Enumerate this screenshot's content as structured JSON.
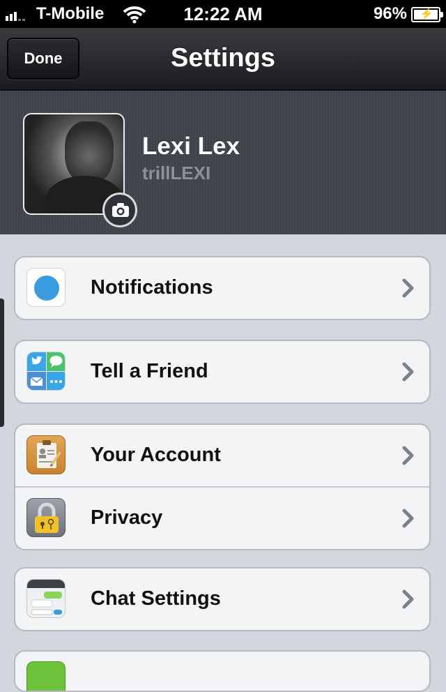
{
  "status_bar": {
    "carrier": "T-Mobile",
    "time": "12:22 AM",
    "battery": "96%"
  },
  "nav": {
    "done_label": "Done",
    "title": "Settings"
  },
  "profile": {
    "name": "Lexi Lex",
    "handle": "trillLEXI"
  },
  "settings": {
    "groups": [
      {
        "rows": [
          {
            "label": "Notifications",
            "icon": "notifications-icon"
          }
        ]
      },
      {
        "rows": [
          {
            "label": "Tell a Friend",
            "icon": "tell-a-friend-icon"
          }
        ]
      },
      {
        "rows": [
          {
            "label": "Your Account",
            "icon": "account-icon"
          },
          {
            "label": "Privacy",
            "icon": "privacy-lock-icon"
          }
        ]
      },
      {
        "rows": [
          {
            "label": "Chat Settings",
            "icon": "chat-settings-icon"
          }
        ]
      }
    ]
  },
  "colors": {
    "accent_blue": "#3a9be0",
    "background": "#d3d6dc"
  }
}
